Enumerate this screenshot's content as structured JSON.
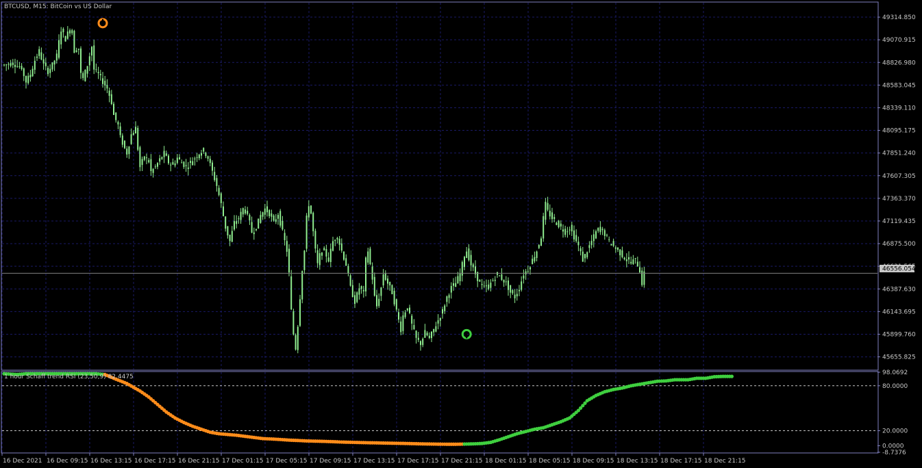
{
  "window": {
    "title": "BTCUSD, M15:  BitCoin vs US Dollar"
  },
  "colors": {
    "background": "#000000",
    "grid": "#1a1a66",
    "candle": "#90ee90",
    "frame": "#8080c0",
    "up_color": "#3fcf3f",
    "down_color": "#ff8c1a",
    "price_line": "#808080",
    "text": "#c8c8c8"
  },
  "chart_data": [
    {
      "type": "candlestick",
      "title": "BTCUSD, M15:  BitCoin vs US Dollar",
      "ylim": [
        45520,
        49470
      ],
      "y_ticks": [
        "49314.850",
        "49070.915",
        "48826.980",
        "48583.045",
        "48339.110",
        "48095.175",
        "47851.240",
        "47607.305",
        "47363.370",
        "47119.435",
        "46875.500",
        "46631.565",
        "46387.630",
        "46143.695",
        "45899.760",
        "45655.825"
      ],
      "current_price": "46556.054",
      "x_ticks": [
        "16 Dec 2021",
        "16 Dec 09:15",
        "16 Dec 13:15",
        "16 Dec 17:15",
        "16 Dec 21:15",
        "17 Dec 01:15",
        "17 Dec 05:15",
        "17 Dec 09:15",
        "17 Dec 13:15",
        "17 Dec 17:15",
        "17 Dec 21:15",
        "18 Dec 01:15",
        "18 Dec 05:15",
        "18 Dec 09:15",
        "18 Dec 13:15",
        "18 Dec 17:15",
        "18 Dec 21:15"
      ],
      "close_path": [
        [
          0,
          48800
        ],
        [
          4,
          48820
        ],
        [
          8,
          48760
        ],
        [
          10,
          48620
        ],
        [
          12,
          48700
        ],
        [
          14,
          48850
        ],
        [
          16,
          48950
        ],
        [
          18,
          48800
        ],
        [
          20,
          48730
        ],
        [
          22,
          48800
        ],
        [
          24,
          48900
        ],
        [
          25,
          49050
        ],
        [
          26,
          49180
        ],
        [
          28,
          49080
        ],
        [
          30,
          49200
        ],
        [
          31,
          49150
        ],
        [
          32,
          48950
        ],
        [
          34,
          48980
        ],
        [
          35,
          48700
        ],
        [
          36,
          48650
        ],
        [
          38,
          48800
        ],
        [
          40,
          49000
        ],
        [
          41,
          48750
        ],
        [
          43,
          48700
        ],
        [
          45,
          48620
        ],
        [
          47,
          48550
        ],
        [
          49,
          48400
        ],
        [
          50,
          48260
        ],
        [
          52,
          48150
        ],
        [
          53,
          48020
        ],
        [
          55,
          47900
        ],
        [
          56,
          47850
        ],
        [
          58,
          48050
        ],
        [
          60,
          48120
        ],
        [
          61,
          47900
        ],
        [
          62,
          47700
        ],
        [
          64,
          47820
        ],
        [
          66,
          47760
        ],
        [
          67,
          47650
        ],
        [
          69,
          47700
        ],
        [
          71,
          47780
        ],
        [
          73,
          47850
        ],
        [
          75,
          47750
        ],
        [
          77,
          47720
        ],
        [
          79,
          47800
        ],
        [
          81,
          47750
        ],
        [
          83,
          47700
        ],
        [
          85,
          47750
        ],
        [
          87,
          47800
        ],
        [
          89,
          47850
        ],
        [
          91,
          47880
        ],
        [
          93,
          47800
        ],
        [
          95,
          47650
        ],
        [
          97,
          47500
        ],
        [
          99,
          47300
        ],
        [
          101,
          47050
        ],
        [
          103,
          46900
        ],
        [
          105,
          47100
        ],
        [
          107,
          47150
        ],
        [
          109,
          47250
        ],
        [
          111,
          47200
        ],
        [
          113,
          47000
        ],
        [
          115,
          47050
        ],
        [
          117,
          47180
        ],
        [
          119,
          47250
        ],
        [
          121,
          47200
        ],
        [
          123,
          47100
        ],
        [
          125,
          47200
        ],
        [
          127,
          47000
        ],
        [
          129,
          46800
        ],
        [
          130,
          46550
        ],
        [
          131,
          46150
        ],
        [
          132,
          45900
        ],
        [
          133,
          45750
        ],
        [
          134,
          46000
        ],
        [
          135,
          46300
        ],
        [
          136,
          46600
        ],
        [
          137,
          46800
        ],
        [
          138,
          47150
        ],
        [
          139,
          47300
        ],
        [
          140,
          47200
        ],
        [
          141,
          47000
        ],
        [
          142,
          46800
        ],
        [
          143,
          46650
        ],
        [
          144,
          46750
        ],
        [
          146,
          46800
        ],
        [
          148,
          46700
        ],
        [
          150,
          46900
        ],
        [
          152,
          46950
        ],
        [
          154,
          46800
        ],
        [
          156,
          46650
        ],
        [
          158,
          46400
        ],
        [
          160,
          46250
        ],
        [
          162,
          46400
        ],
        [
          164,
          46350
        ],
        [
          165,
          46700
        ],
        [
          166,
          46800
        ],
        [
          168,
          46500
        ],
        [
          169,
          46300
        ],
        [
          170,
          46200
        ],
        [
          172,
          46400
        ],
        [
          173,
          46550
        ],
        [
          175,
          46450
        ],
        [
          177,
          46350
        ],
        [
          179,
          46150
        ],
        [
          181,
          45950
        ],
        [
          182,
          46100
        ],
        [
          184,
          46200
        ],
        [
          186,
          46000
        ],
        [
          188,
          45850
        ],
        [
          190,
          45800
        ],
        [
          192,
          45920
        ],
        [
          194,
          45850
        ],
        [
          196,
          45950
        ],
        [
          198,
          46050
        ],
        [
          200,
          46150
        ],
        [
          202,
          46300
        ],
        [
          204,
          46400
        ],
        [
          206,
          46450
        ],
        [
          208,
          46550
        ],
        [
          210,
          46750
        ],
        [
          211,
          46800
        ],
        [
          213,
          46650
        ],
        [
          215,
          46550
        ],
        [
          217,
          46450
        ],
        [
          219,
          46400
        ],
        [
          221,
          46420
        ],
        [
          223,
          46480
        ],
        [
          225,
          46550
        ],
        [
          227,
          46500
        ],
        [
          229,
          46450
        ],
        [
          231,
          46350
        ],
        [
          233,
          46300
        ],
        [
          235,
          46400
        ],
        [
          237,
          46550
        ],
        [
          239,
          46600
        ],
        [
          241,
          46700
        ],
        [
          243,
          46800
        ],
        [
          245,
          46950
        ],
        [
          246,
          47150
        ],
        [
          247,
          47300
        ],
        [
          248,
          47220
        ],
        [
          250,
          47150
        ],
        [
          252,
          47100
        ],
        [
          254,
          47050
        ],
        [
          256,
          47000
        ],
        [
          258,
          47050
        ],
        [
          260,
          46950
        ],
        [
          262,
          46850
        ],
        [
          264,
          46700
        ],
        [
          266,
          46800
        ],
        [
          268,
          46900
        ],
        [
          270,
          47000
        ],
        [
          272,
          47050
        ],
        [
          274,
          46980
        ],
        [
          276,
          46900
        ],
        [
          278,
          46850
        ],
        [
          280,
          46800
        ],
        [
          282,
          46750
        ],
        [
          284,
          46700
        ],
        [
          286,
          46680
        ],
        [
          288,
          46700
        ],
        [
          289,
          46650
        ],
        [
          290,
          46580
        ],
        [
          291,
          46450
        ],
        [
          292,
          46550
        ]
      ],
      "annotations": [
        {
          "type": "down-arrow",
          "color": "orange",
          "bar": 45
        },
        {
          "type": "up-arrow",
          "color": "green",
          "bar": 211
        }
      ]
    },
    {
      "type": "line",
      "title": "1 hour Schaff trend RSI (23,50,9) 82.4475",
      "ylim": [
        0,
        98.0692
      ],
      "y_ticks": [
        "98.0692",
        "80.0000",
        "20.0000",
        "0.0000",
        "-8.7376"
      ],
      "levels": [
        80,
        20
      ],
      "series": [
        {
          "points": [
            [
              0,
              96
            ],
            [
              6,
              95
            ],
            [
              10,
              96
            ],
            [
              20,
              96
            ],
            [
              30,
              96
            ],
            [
              38,
              96
            ],
            [
              42,
              96
            ],
            [
              46,
              95
            ],
            [
              50,
              90
            ],
            [
              56,
              83
            ],
            [
              62,
              73
            ],
            [
              66,
              65
            ],
            [
              70,
              55
            ],
            [
              74,
              45
            ],
            [
              78,
              37
            ],
            [
              82,
              31
            ],
            [
              86,
              26
            ],
            [
              90,
              22
            ],
            [
              94,
              18
            ],
            [
              98,
              16
            ],
            [
              102,
              15
            ],
            [
              106,
              14
            ],
            [
              110,
              12.5
            ],
            [
              114,
              11
            ],
            [
              118,
              9.5
            ],
            [
              122,
              9
            ],
            [
              126,
              8.3
            ],
            [
              130,
              7.5
            ],
            [
              134,
              7
            ],
            [
              138,
              6.4
            ],
            [
              142,
              6.1
            ],
            [
              146,
              5.8
            ],
            [
              150,
              5.4
            ],
            [
              154,
              4.9
            ],
            [
              158,
              4.6
            ],
            [
              162,
              4.3
            ],
            [
              166,
              4
            ],
            [
              170,
              3.8
            ],
            [
              174,
              3.5
            ],
            [
              178,
              3.3
            ],
            [
              182,
              3.1
            ],
            [
              186,
              2.8
            ],
            [
              190,
              2.5
            ],
            [
              194,
              2.3
            ],
            [
              198,
              2.1
            ],
            [
              202,
              2
            ],
            [
              206,
              2
            ],
            [
              210,
              2.2
            ],
            [
              214,
              2.5
            ],
            [
              218,
              3
            ],
            [
              222,
              4.5
            ],
            [
              226,
              8
            ],
            [
              230,
              12
            ],
            [
              234,
              16
            ],
            [
              238,
              19
            ],
            [
              242,
              22
            ],
            [
              246,
              24
            ],
            [
              250,
              28
            ],
            [
              254,
              32
            ],
            [
              258,
              37
            ],
            [
              262,
              47
            ],
            [
              266,
              60
            ],
            [
              270,
              67
            ],
            [
              274,
              72
            ],
            [
              278,
              75
            ],
            [
              282,
              77
            ],
            [
              286,
              80
            ],
            [
              290,
              82
            ],
            [
              294,
              84
            ],
            [
              298,
              86
            ],
            [
              302,
              86.5
            ],
            [
              306,
              88
            ],
            [
              310,
              88
            ],
            [
              312,
              88
            ],
            [
              316,
              90
            ],
            [
              320,
              90
            ],
            [
              324,
              92
            ],
            [
              328,
              92.5
            ],
            [
              332,
              92.5
            ]
          ],
          "colors_by_range": [
            {
              "from": 0,
              "to": 33,
              "color": "up"
            },
            {
              "from": 33,
              "to": 46,
              "color": "up"
            },
            {
              "from": 46,
              "to": 210,
              "color": "down"
            },
            {
              "from": 210,
              "to": 332,
              "color": "up"
            }
          ]
        }
      ]
    }
  ]
}
